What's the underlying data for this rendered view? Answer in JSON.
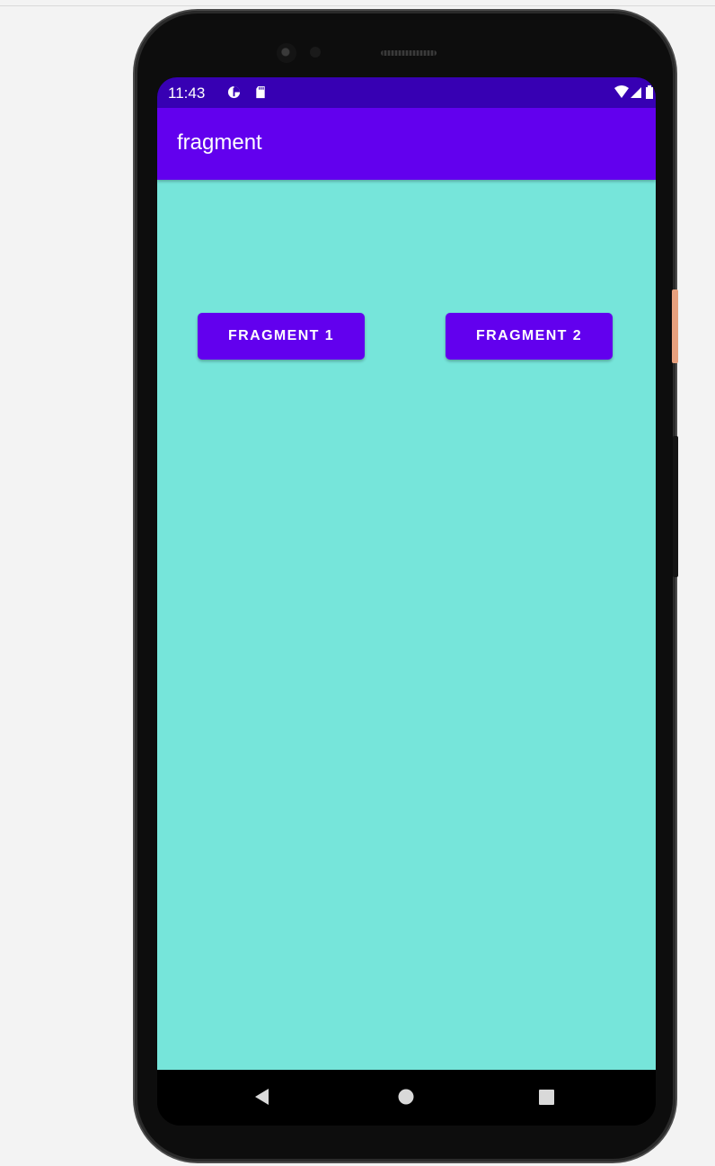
{
  "status_bar": {
    "time": "11:43",
    "icons": [
      "data-saver-icon",
      "sd-card-icon",
      "wifi-icon",
      "signal-icon",
      "battery-icon"
    ]
  },
  "app_bar": {
    "title": "fragment"
  },
  "main": {
    "buttons": [
      {
        "label": "FRAGMENT 1"
      },
      {
        "label": "FRAGMENT 2"
      }
    ]
  },
  "nav_bar": {
    "icons": [
      "back-icon",
      "home-icon",
      "recents-icon"
    ]
  },
  "colors": {
    "status_bar": "#3700b3",
    "app_bar": "#6200ee",
    "background": "#76e5da",
    "button": "#6200ee",
    "button_text": "#ffffff"
  }
}
